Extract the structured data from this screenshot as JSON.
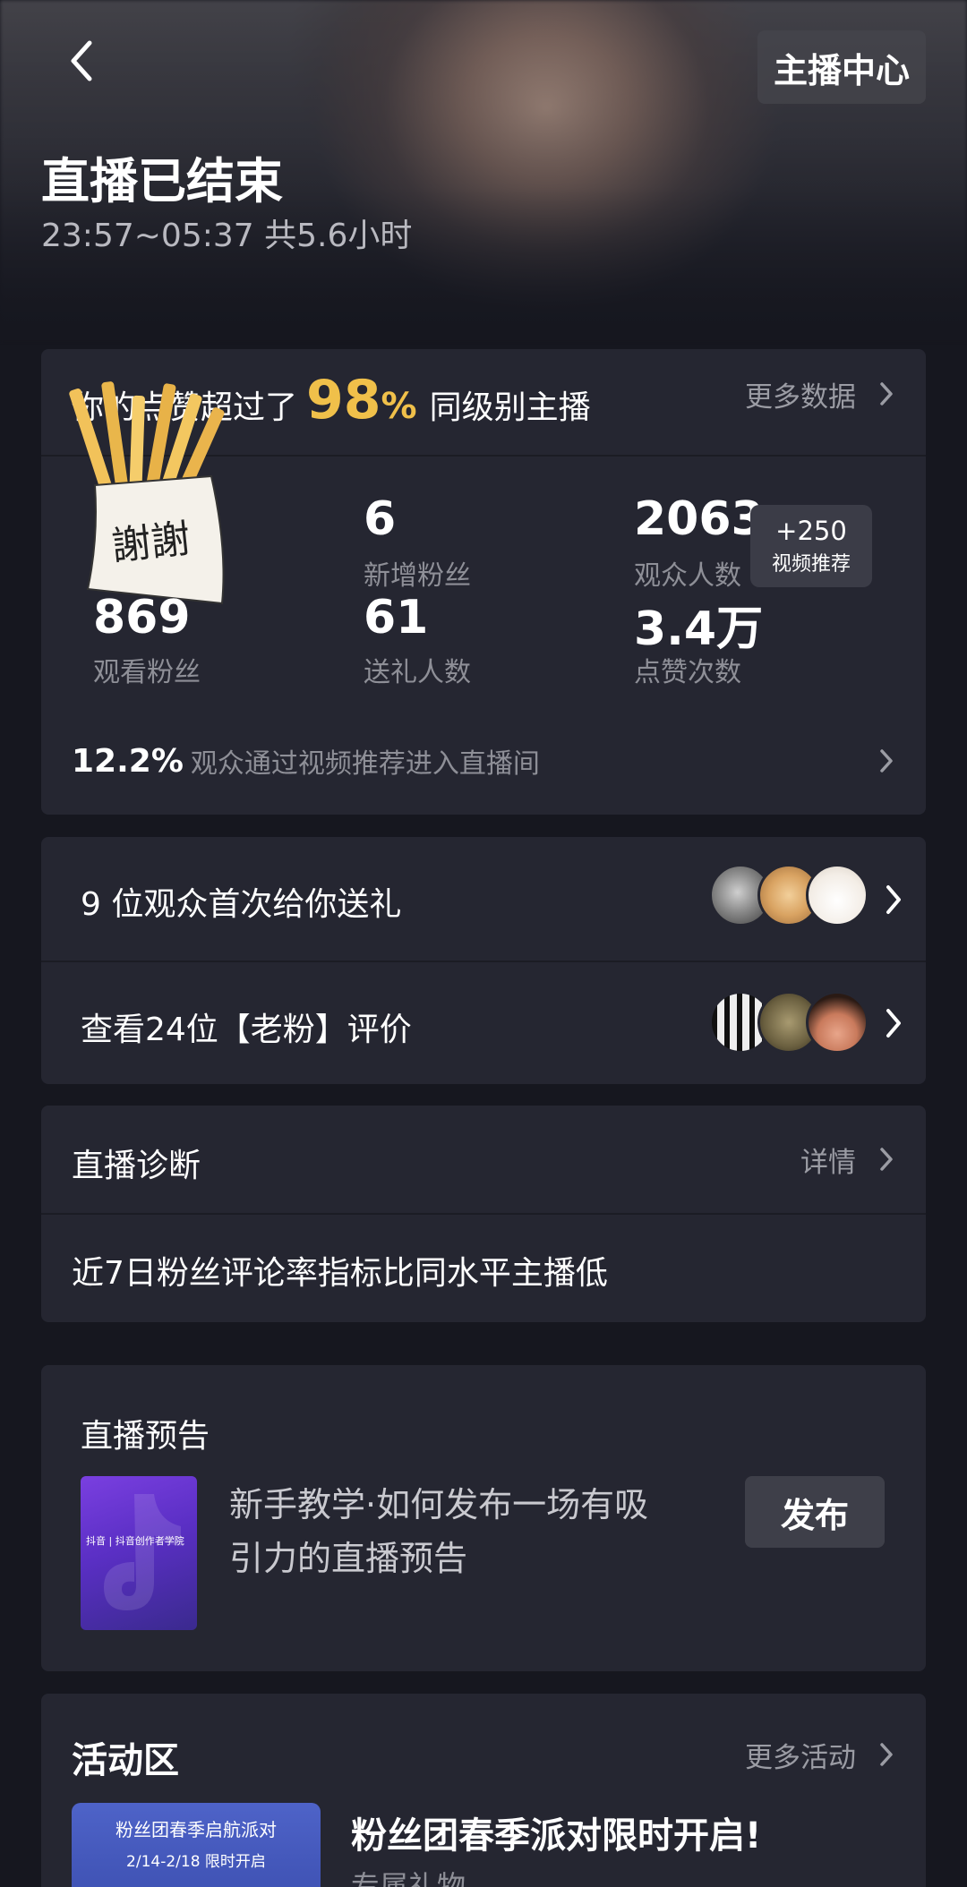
{
  "header": {
    "center_button": "主播中心",
    "title": "直播已结束",
    "time_range": "23:57~05:37 共5.6小时"
  },
  "summary": {
    "prefix": "你的点赞超过了",
    "percent": "98",
    "percent_sign": "%",
    "suffix": "同级别主播",
    "more_link": "更多数据",
    "sticker_text": "謝謝"
  },
  "stats": [
    {
      "value": "869",
      "label": "观看粉丝"
    },
    {
      "value": "6",
      "label": "新增粉丝"
    },
    {
      "value": "2063",
      "label": "观众人数"
    },
    {
      "value": "61",
      "label": "送礼人数"
    },
    {
      "value": "3.4万",
      "label": "点赞次数"
    }
  ],
  "video_badge": {
    "count": "+250",
    "label": "视频推荐"
  },
  "recommend": {
    "percent": "12.2%",
    "text": "观众通过视频推荐进入直播间"
  },
  "gifts_row": {
    "text": "9 位观众首次给你送礼"
  },
  "fans_row": {
    "text": "查看24位【老粉】评价"
  },
  "diagnosis": {
    "title": "直播诊断",
    "link": "详情",
    "message": "近7日粉丝评论率指标比同水平主播低"
  },
  "preview": {
    "title": "直播预告",
    "tutorial": "新手教学·如何发布一场有吸引力的直播预告",
    "tutorial_line1": "新手教学·如何发布一场有吸",
    "tutorial_line2": "引力的直播预告",
    "thumb_caption": "抖音 | 抖音创作者学院",
    "publish_button": "发布"
  },
  "activity": {
    "title": "活动区",
    "more_link": "更多活动",
    "banner_line1": "粉丝团春季启航派对",
    "banner_line2": "2/14-2/18 限时开启",
    "item_title": "粉丝团春季派对限时开启!",
    "item_sub": "专属礼物"
  }
}
